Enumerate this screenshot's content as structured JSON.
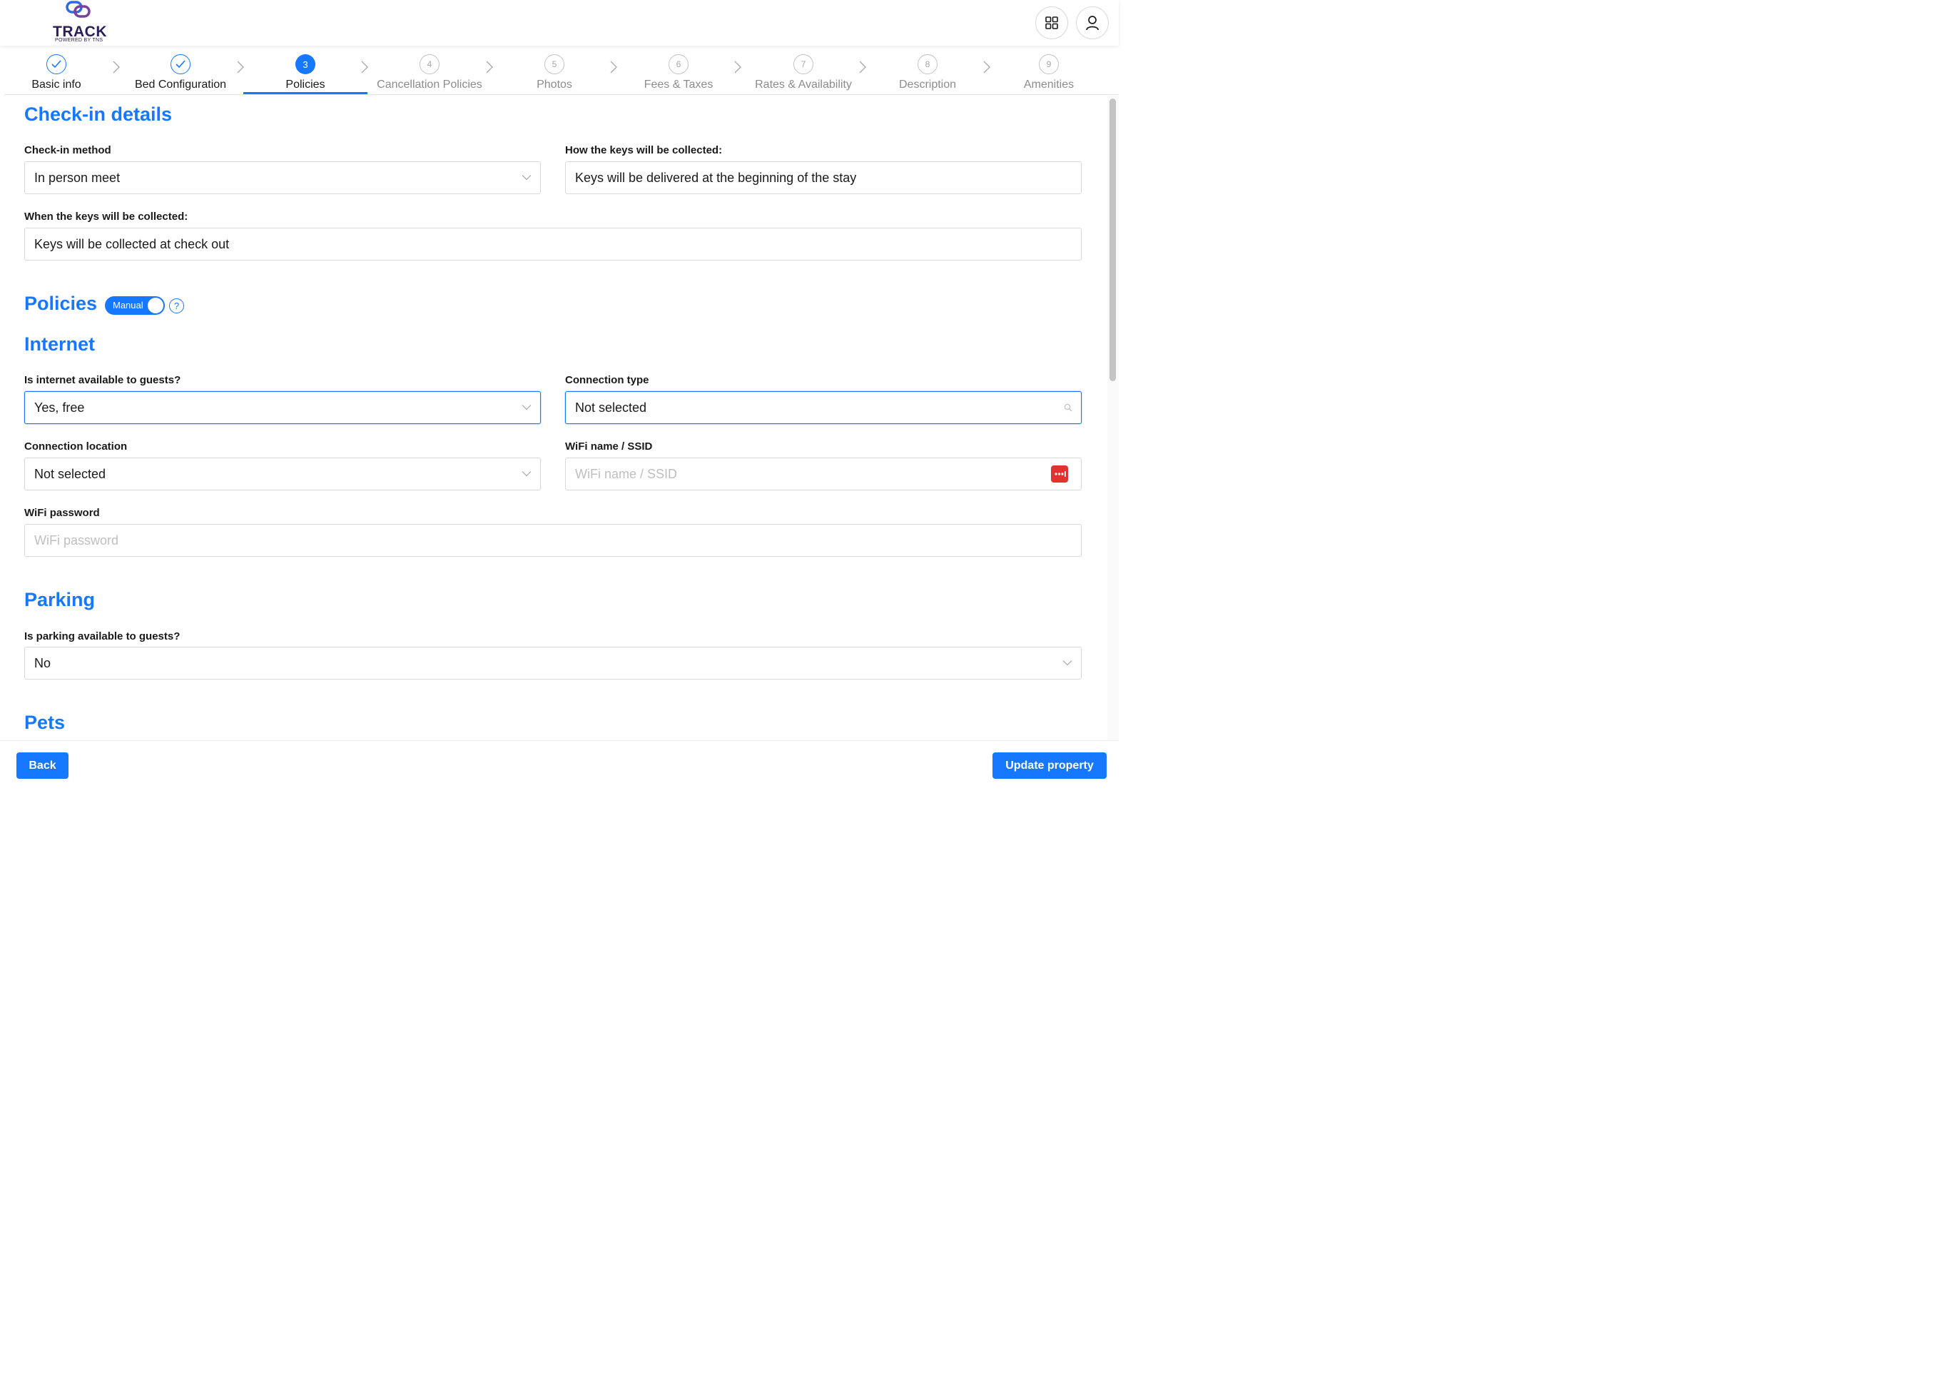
{
  "app": {
    "logo_text": "TRACK",
    "logo_sub": "POWERED BY TNS"
  },
  "stepper": {
    "steps": [
      {
        "num": "",
        "label": "Basic info",
        "state": "done"
      },
      {
        "num": "",
        "label": "Bed Configuration",
        "state": "done"
      },
      {
        "num": "3",
        "label": "Policies",
        "state": "active"
      },
      {
        "num": "4",
        "label": "Cancellation Policies",
        "state": "todo"
      },
      {
        "num": "5",
        "label": "Photos",
        "state": "todo"
      },
      {
        "num": "6",
        "label": "Fees & Taxes",
        "state": "todo"
      },
      {
        "num": "7",
        "label": "Rates & Availability",
        "state": "todo"
      },
      {
        "num": "8",
        "label": "Description",
        "state": "todo"
      },
      {
        "num": "9",
        "label": "Amenities",
        "state": "todo"
      }
    ]
  },
  "checkin": {
    "title": "Check-in details",
    "method_label": "Check-in method",
    "method_value": "In person meet",
    "keys_how_label": "How the keys will be collected:",
    "keys_how_value": "Keys will be delivered at the beginning of the stay",
    "keys_when_label": "When the keys will be collected:",
    "keys_when_value": "Keys will be collected at check out"
  },
  "policies": {
    "title": "Policies",
    "toggle_label": "Manual",
    "help_glyph": "?"
  },
  "internet": {
    "title": "Internet",
    "available_label": "Is internet available to guests?",
    "available_value": "Yes, free",
    "conn_type_label": "Connection type",
    "conn_type_value": "Not selected",
    "conn_location_label": "Connection location",
    "conn_location_value": "Not selected",
    "wifi_name_label": "WiFi name / SSID",
    "wifi_name_placeholder": "WiFi name / SSID",
    "wifi_password_label": "WiFi password",
    "wifi_password_placeholder": "WiFi password"
  },
  "parking": {
    "title": "Parking",
    "available_label": "Is parking available to guests?",
    "available_value": "No"
  },
  "pets": {
    "title": "Pets"
  },
  "footer": {
    "back_label": "Back",
    "update_label": "Update property"
  },
  "colors": {
    "accent": "#1677ff",
    "brand": "#2b1d57",
    "password_manager": "#e0332f"
  },
  "icons": [
    "apps-grid-icon",
    "user-icon",
    "check-icon",
    "chevron-right-icon",
    "chevron-down-icon",
    "search-icon",
    "password-manager-icon",
    "help-icon"
  ]
}
